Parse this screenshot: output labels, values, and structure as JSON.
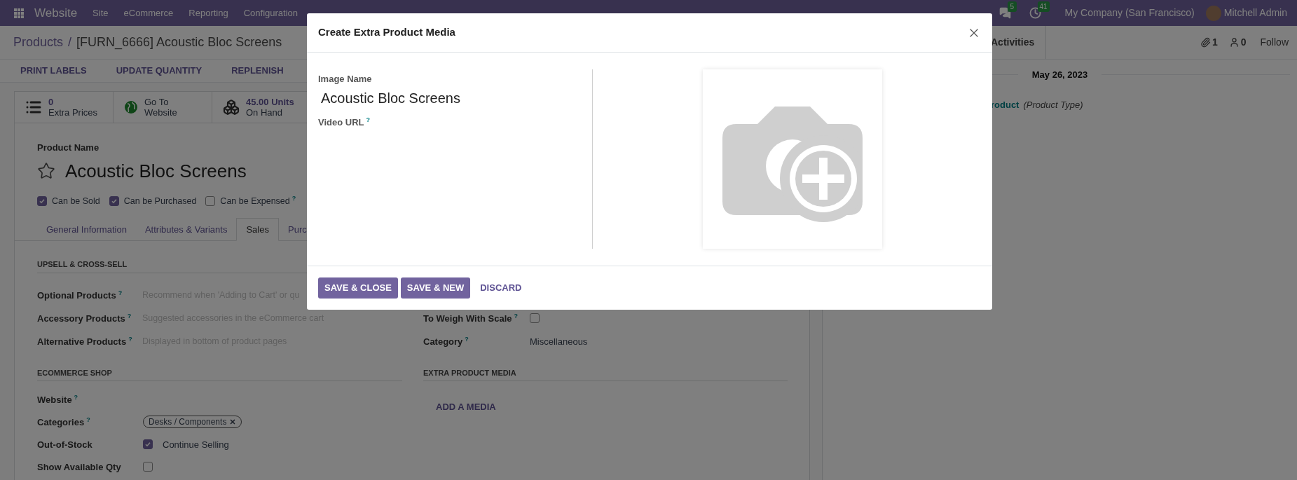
{
  "navbar": {
    "app": "Website",
    "menus": [
      "Site",
      "eCommerce",
      "Reporting",
      "Configuration"
    ],
    "messages_badge": "5",
    "activities_badge": "41",
    "company": "My Company (San Francisco)",
    "user": "Mitchell Admin"
  },
  "breadcrumb": {
    "parent": "Products",
    "separator": "/",
    "current": "[FURN_6666] Acoustic Bloc Screens"
  },
  "chatter_bar": {
    "activities": "Activities",
    "attachments": "1",
    "followers": "0",
    "follow": "Follow"
  },
  "actions": [
    "PRINT LABELS",
    "UPDATE QUANTITY",
    "REPLENISH"
  ],
  "stat_buttons": [
    {
      "kind": "list",
      "line1": "0",
      "line2": "Extra Prices",
      "highlight": true
    },
    {
      "kind": "globe",
      "line1": "Go To",
      "line2": "Website",
      "highlight": false
    },
    {
      "kind": "cubes",
      "line1": "45.00 Units",
      "line2": "On Hand",
      "highlight": true
    }
  ],
  "product": {
    "name_label": "Product Name",
    "name": "Acoustic Bloc Screens",
    "favorite": false,
    "options": [
      {
        "label": "Can be Sold",
        "checked": true
      },
      {
        "label": "Can be Purchased",
        "checked": true
      },
      {
        "label": "Can be Expensed",
        "checked": false,
        "help": "?"
      }
    ]
  },
  "tabs": [
    {
      "label": "General Information",
      "selected": false
    },
    {
      "label": "Attributes & Variants",
      "selected": false
    },
    {
      "label": "Sales",
      "selected": true
    },
    {
      "label": "Purc",
      "selected": false
    }
  ],
  "upsell": {
    "title": "UPSELL & CROSS-SELL",
    "fields": [
      {
        "label": "Optional Products",
        "help": "?",
        "placeholder": "Recommend when 'Adding to Cart' or qu"
      },
      {
        "label": "Accessory Products",
        "help": "?",
        "placeholder": "Suggested accessories in the eCommerce cart"
      },
      {
        "label": "Alternative Products",
        "help": "?",
        "placeholder": "Displayed in bottom of product pages"
      }
    ]
  },
  "pos_fields": [
    {
      "kind": "checkbox",
      "label": "To Weigh With Scale",
      "help": "?",
      "checked": false
    },
    {
      "kind": "text",
      "label": "Category",
      "help": "?",
      "value": "Miscellaneous"
    }
  ],
  "ecommerce": {
    "title": "ECOMMERCE SHOP",
    "fields": [
      {
        "kind": "empty",
        "label": "Website",
        "help": "?"
      },
      {
        "kind": "tags",
        "label": "Categories",
        "help": "?",
        "tags": [
          "Desks / Components"
        ]
      },
      {
        "kind": "checkbox",
        "label": "Out-of-Stock",
        "checked": true,
        "text": "Continue Selling"
      },
      {
        "kind": "checkbox",
        "label": "Show Available Qty",
        "checked": false
      }
    ]
  },
  "extra_media": {
    "title": "EXTRA PRODUCT MEDIA",
    "add": "ADD A MEDIA"
  },
  "chatter": {
    "date": "May 26, 2023",
    "link": "roduct",
    "note": "(Product Type)"
  },
  "modal": {
    "title": "Create Extra Product Media",
    "image_name_label": "Image Name",
    "image_name": "Acoustic Bloc Screens",
    "video_label": "Video URL",
    "video_help": "?",
    "buttons": [
      {
        "label": "SAVE & CLOSE",
        "kind": "primary"
      },
      {
        "label": "SAVE & NEW",
        "kind": "primary"
      },
      {
        "label": "DISCARD",
        "kind": "link"
      }
    ]
  }
}
